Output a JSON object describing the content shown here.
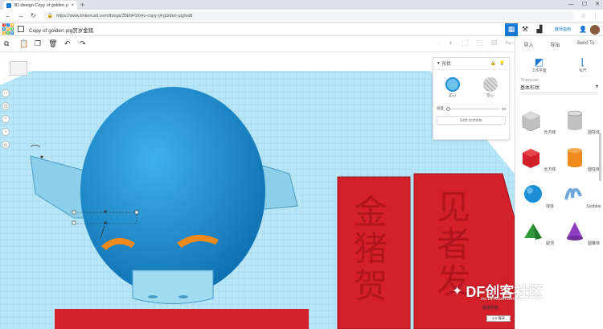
{
  "browser": {
    "tab_title": "3D design Copy of golden pig",
    "tab_close": "×",
    "new_tab": "+",
    "url": "https://www.tinkercad.com/things/35bhF0Xelo-copy-of-golden-pig/edit"
  },
  "header": {
    "project_title": "Copy of golden pig贺岁金猪",
    "language_link": "教师指南",
    "logo_letters": [
      "T",
      "I",
      "N",
      "K",
      "E",
      "R",
      "C",
      "A",
      "D"
    ]
  },
  "panel": {
    "actions": [
      "导入",
      "导出",
      "Send To"
    ],
    "views": [
      "工作平面",
      "标尺"
    ],
    "library_label": "Tinkercad",
    "library_value": "基本形状",
    "shapes": [
      {
        "label": "长方体",
        "icon": "box-hole-icon",
        "color": "#b8b8b8"
      },
      {
        "label": "圆柱体",
        "icon": "cylinder-hole-icon",
        "color": "#b8b8b8"
      },
      {
        "label": "长方体",
        "icon": "box-icon",
        "color": "#d4202a"
      },
      {
        "label": "圆柱体",
        "icon": "cylinder-icon",
        "color": "#f08a1c"
      },
      {
        "label": "球体",
        "icon": "sphere-icon",
        "color": "#1b8ed6"
      },
      {
        "label": "Scribble",
        "icon": "scribble-icon",
        "color": "#6fa8dc"
      },
      {
        "label": "屋顶",
        "icon": "roof-icon",
        "color": "#2f9a3a"
      },
      {
        "label": "圆锥体",
        "icon": "cone-icon",
        "color": "#8c3fbf"
      }
    ]
  },
  "inspector": {
    "title": "形状",
    "solid_label": "实心",
    "hole_label": "空心",
    "slider_label": "高度",
    "slider_value": "10",
    "edit_label": "Edit scribble"
  },
  "canvas": {
    "cn_left": [
      "金",
      "猪",
      "贺"
    ],
    "cn_right": [
      "见",
      "者",
      "发"
    ]
  },
  "footer": {
    "snap_label": "编辑网格",
    "snap_value": "1.0 毫米",
    "watermark": "DF创客社区",
    "watermark_sub": "mc.DFRobot.com.cn"
  },
  "colors": {
    "accent": "#1477d1",
    "pig_blue": "#1b8ed6",
    "ear_blue": "#8ccfea",
    "red": "#d4202a",
    "orange": "#f08a1c",
    "grid": "#9fdcf2"
  }
}
